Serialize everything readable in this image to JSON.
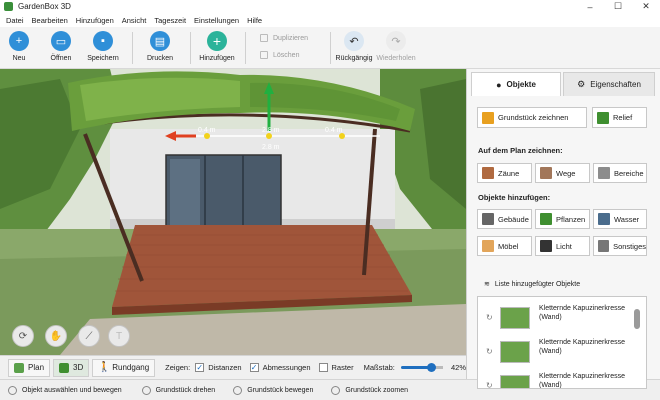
{
  "window": {
    "title": "GardenBox 3D",
    "controls": [
      "–",
      "☐",
      "✕"
    ]
  },
  "menu": [
    "Datei",
    "Bearbeiten",
    "Hinzufügen",
    "Ansicht",
    "Tageszeit",
    "Einstellungen",
    "Hilfe"
  ],
  "toolbar": {
    "new": "Neu",
    "open": "Öffnen",
    "save": "Speichern",
    "print": "Drucken",
    "add": "Hinzufügen",
    "duplicate": "Duplizieren",
    "delete": "Löschen",
    "undo": "Rückgängig",
    "redo": "Wiederholen"
  },
  "viewport": {
    "dim_left": "0.4 m",
    "dim_mid": "2.8 m",
    "dim_mid_below": "2.8 m",
    "dim_right": "0.4 m"
  },
  "modebar": {
    "plan": "Plan",
    "three_d": "3D",
    "tour": "Rundgang",
    "show_label": "Zeigen:",
    "distances": "Distanzen",
    "dimensions": "Abmessungen",
    "grid": "Raster",
    "scale_label": "Maßstab:",
    "scale_value": "42%",
    "distances_checked": true,
    "dimensions_checked": true,
    "grid_checked": false
  },
  "status": {
    "select": "Objekt auswählen und bewegen",
    "rotate": "Grundstück drehen",
    "move": "Grundstück bewegen",
    "zoom": "Grundstück zoomen"
  },
  "panel": {
    "tab_objects": "Objekte",
    "tab_properties": "Eigenschaften",
    "draw_plot": "Grundstück zeichnen",
    "relief": "Relief",
    "draw_on_plan": "Auf dem Plan zeichnen:",
    "fences": "Zäune",
    "paths": "Wege",
    "areas": "Bereiche",
    "add_objects": "Objekte hinzufügen:",
    "buildings": "Gebäude",
    "plants": "Pflanzen",
    "water": "Wasser",
    "furniture": "Möbel",
    "light": "Licht",
    "other": "Sonstiges",
    "list_title": "Liste hinzugefügter Objekte",
    "list_items": [
      "Kletternde Kapuzinerkresse (Wand)",
      "Kletternde Kapuzinerkresse (Wand)",
      "Kletternde Kapuzinerkresse (Wand)"
    ]
  },
  "colors": {
    "accent": "#1f6fbf",
    "toolbar_blue": "#2f8fd8",
    "add_green": "#2bb39a",
    "status_green": "#2da84a"
  }
}
